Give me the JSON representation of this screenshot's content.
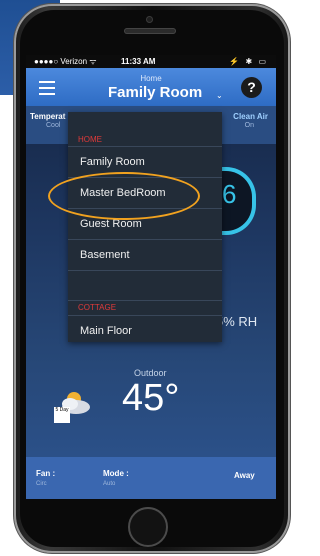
{
  "status_bar": {
    "carrier": "●●●●○ Verizon ᯤ",
    "time": "11:33 AM",
    "right_icons": "⚡ ✱ ▭"
  },
  "app_bar": {
    "home_label": "Home",
    "room_title": "Family Room",
    "dropdown_chevron": "⌄",
    "help_label": "?"
  },
  "tiles": {
    "left_title": "Temperat",
    "left_sub": "Cool",
    "right_title": "Clean Air",
    "right_sub": "On"
  },
  "dial": {
    "digit": "6"
  },
  "humidity": "5% RH",
  "outdoor": {
    "label": "Outdoor",
    "temp": "45°",
    "tag": "5 Day"
  },
  "bottom_bar": {
    "fan_label": "Fan :",
    "fan_value": "Circ",
    "mode_label": "Mode :",
    "mode_value": "Auto",
    "away_label": "Away"
  },
  "dropdown": {
    "section_home": "HOME",
    "items": [
      "Family Room",
      "Master BedRoom",
      "Guest Room",
      "Basement"
    ],
    "section_cottage": "COTTAGE",
    "cottage_items": [
      "Main Floor"
    ]
  },
  "colors": {
    "accent": "#4c89dd",
    "section_red": "#e03a3a",
    "highlight_orange": "#f1a21f",
    "dial_cyan": "#37c3e8"
  },
  "icons": {
    "menu": "hamburger-menu-icon",
    "help": "question-circle-icon",
    "weather": "partly-cloudy-icon"
  }
}
